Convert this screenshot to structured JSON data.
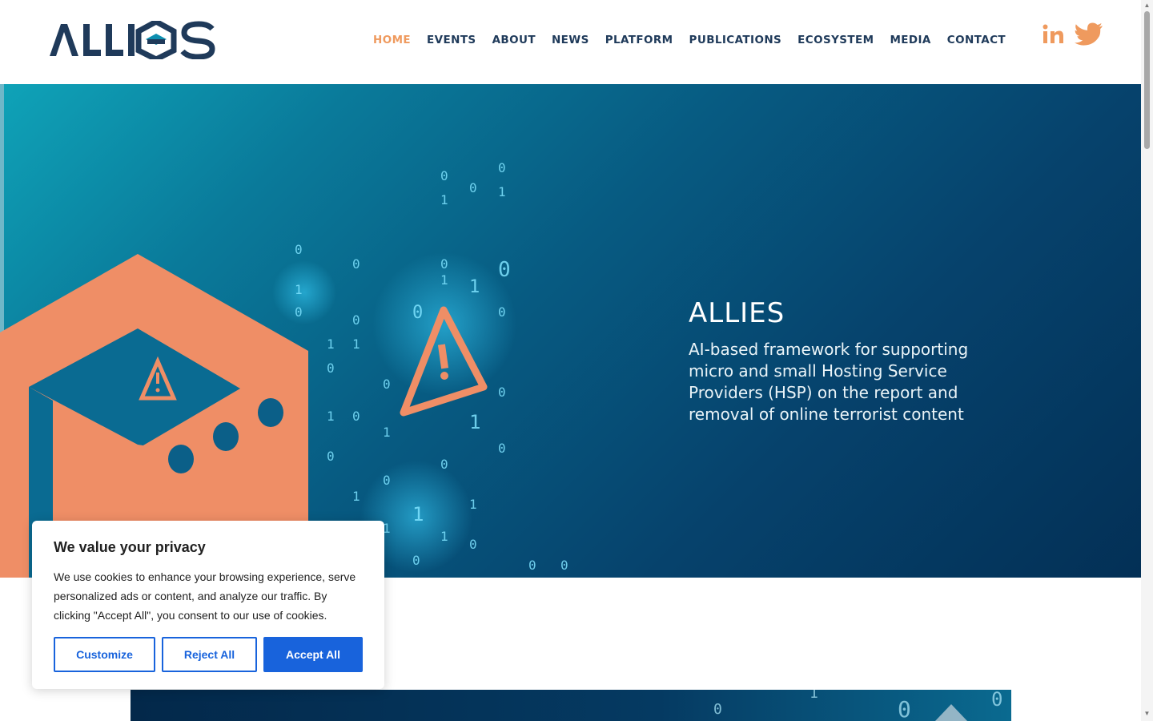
{
  "brand": {
    "logo_text": "ALLIES",
    "accent_color": "#ef9a5e",
    "navy_color": "#1f3a5a"
  },
  "nav": {
    "items": [
      {
        "label": "HOME",
        "active": true
      },
      {
        "label": "EVENTS",
        "active": false
      },
      {
        "label": "ABOUT",
        "active": false
      },
      {
        "label": "NEWS",
        "active": false
      },
      {
        "label": "PLATFORM",
        "active": false
      },
      {
        "label": "PUBLICATIONS",
        "active": false
      },
      {
        "label": "ECOSYSTEM",
        "active": false
      },
      {
        "label": "MEDIA",
        "active": false
      },
      {
        "label": "CONTACT",
        "active": false
      }
    ]
  },
  "social": {
    "linkedin_icon": "linkedin-icon",
    "twitter_icon": "twitter-icon"
  },
  "hero": {
    "title": "ALLIES",
    "subtitle": "AI-based framework for supporting micro and small Hosting Service Providers (HSP) on the report and removal of online terrorist content"
  },
  "cookie": {
    "title": "We value your privacy",
    "text": "We use cookies to enhance your browsing experience, serve personalized ads or content, and analyze our traffic. By clicking \"Accept All\", you consent to our use of cookies.",
    "customize_label": "Customize",
    "reject_label": "Reject All",
    "accept_label": "Accept All",
    "primary_color": "#1863dc"
  }
}
